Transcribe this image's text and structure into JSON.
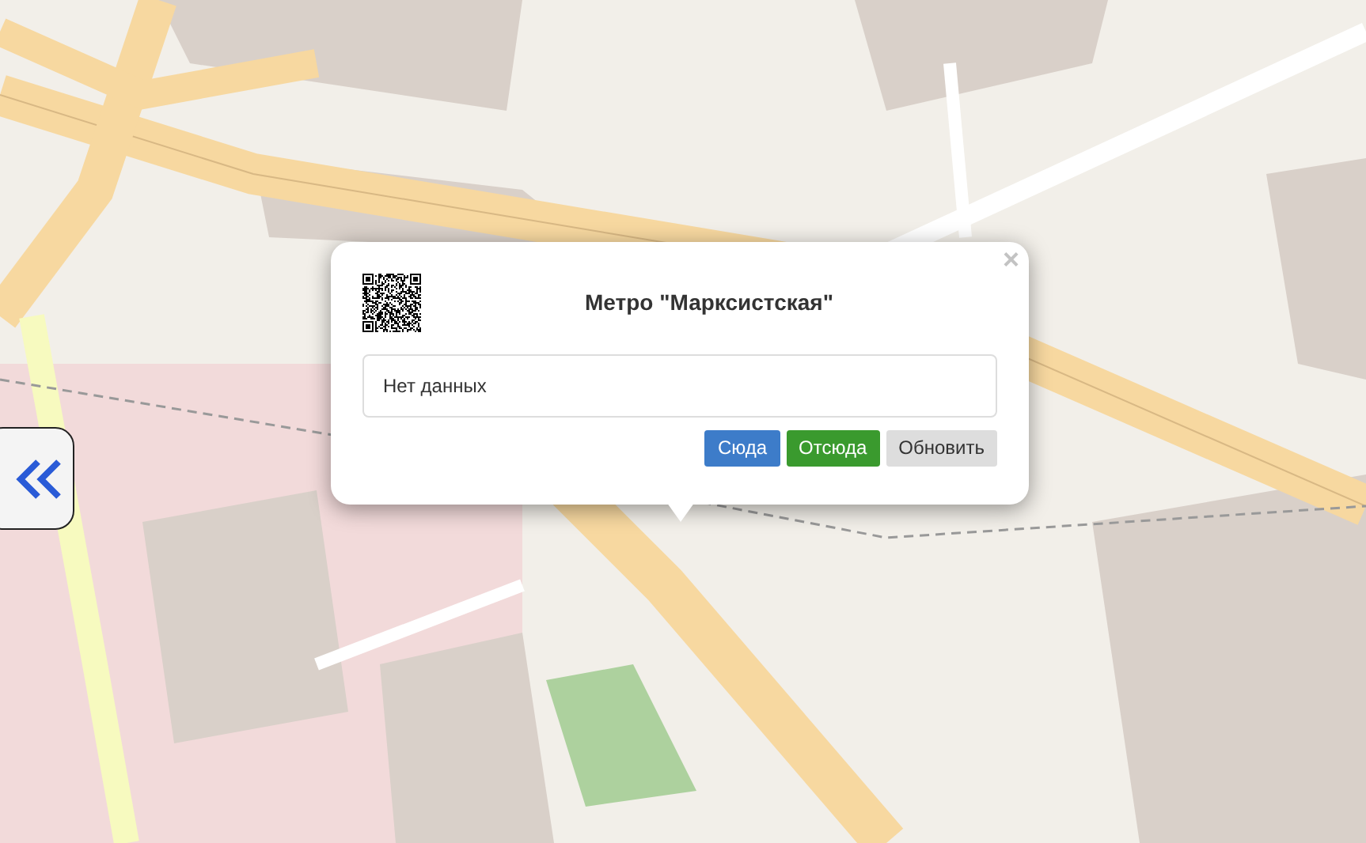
{
  "popup": {
    "title": "Метро \"Марксистская\"",
    "close": "×",
    "content": "Нет данных",
    "buttons": [
      {
        "label": "Сюда",
        "kind": "primary"
      },
      {
        "label": "Отсюда",
        "kind": "success"
      },
      {
        "label": "Обновить",
        "kind": "secondary"
      }
    ]
  }
}
